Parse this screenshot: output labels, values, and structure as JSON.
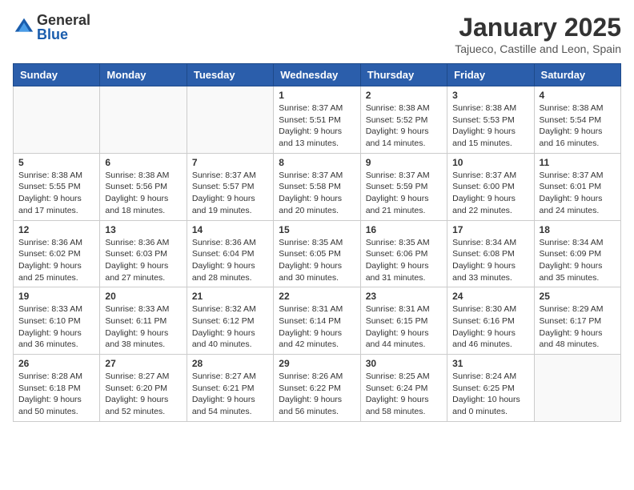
{
  "logo": {
    "general": "General",
    "blue": "Blue"
  },
  "title": "January 2025",
  "location": "Tajueco, Castille and Leon, Spain",
  "weekdays": [
    "Sunday",
    "Monday",
    "Tuesday",
    "Wednesday",
    "Thursday",
    "Friday",
    "Saturday"
  ],
  "weeks": [
    [
      {
        "day": "",
        "sunrise": "",
        "sunset": "",
        "daylight": ""
      },
      {
        "day": "",
        "sunrise": "",
        "sunset": "",
        "daylight": ""
      },
      {
        "day": "",
        "sunrise": "",
        "sunset": "",
        "daylight": ""
      },
      {
        "day": "1",
        "sunrise": "Sunrise: 8:37 AM",
        "sunset": "Sunset: 5:51 PM",
        "daylight": "Daylight: 9 hours and 13 minutes."
      },
      {
        "day": "2",
        "sunrise": "Sunrise: 8:38 AM",
        "sunset": "Sunset: 5:52 PM",
        "daylight": "Daylight: 9 hours and 14 minutes."
      },
      {
        "day": "3",
        "sunrise": "Sunrise: 8:38 AM",
        "sunset": "Sunset: 5:53 PM",
        "daylight": "Daylight: 9 hours and 15 minutes."
      },
      {
        "day": "4",
        "sunrise": "Sunrise: 8:38 AM",
        "sunset": "Sunset: 5:54 PM",
        "daylight": "Daylight: 9 hours and 16 minutes."
      }
    ],
    [
      {
        "day": "5",
        "sunrise": "Sunrise: 8:38 AM",
        "sunset": "Sunset: 5:55 PM",
        "daylight": "Daylight: 9 hours and 17 minutes."
      },
      {
        "day": "6",
        "sunrise": "Sunrise: 8:38 AM",
        "sunset": "Sunset: 5:56 PM",
        "daylight": "Daylight: 9 hours and 18 minutes."
      },
      {
        "day": "7",
        "sunrise": "Sunrise: 8:37 AM",
        "sunset": "Sunset: 5:57 PM",
        "daylight": "Daylight: 9 hours and 19 minutes."
      },
      {
        "day": "8",
        "sunrise": "Sunrise: 8:37 AM",
        "sunset": "Sunset: 5:58 PM",
        "daylight": "Daylight: 9 hours and 20 minutes."
      },
      {
        "day": "9",
        "sunrise": "Sunrise: 8:37 AM",
        "sunset": "Sunset: 5:59 PM",
        "daylight": "Daylight: 9 hours and 21 minutes."
      },
      {
        "day": "10",
        "sunrise": "Sunrise: 8:37 AM",
        "sunset": "Sunset: 6:00 PM",
        "daylight": "Daylight: 9 hours and 22 minutes."
      },
      {
        "day": "11",
        "sunrise": "Sunrise: 8:37 AM",
        "sunset": "Sunset: 6:01 PM",
        "daylight": "Daylight: 9 hours and 24 minutes."
      }
    ],
    [
      {
        "day": "12",
        "sunrise": "Sunrise: 8:36 AM",
        "sunset": "Sunset: 6:02 PM",
        "daylight": "Daylight: 9 hours and 25 minutes."
      },
      {
        "day": "13",
        "sunrise": "Sunrise: 8:36 AM",
        "sunset": "Sunset: 6:03 PM",
        "daylight": "Daylight: 9 hours and 27 minutes."
      },
      {
        "day": "14",
        "sunrise": "Sunrise: 8:36 AM",
        "sunset": "Sunset: 6:04 PM",
        "daylight": "Daylight: 9 hours and 28 minutes."
      },
      {
        "day": "15",
        "sunrise": "Sunrise: 8:35 AM",
        "sunset": "Sunset: 6:05 PM",
        "daylight": "Daylight: 9 hours and 30 minutes."
      },
      {
        "day": "16",
        "sunrise": "Sunrise: 8:35 AM",
        "sunset": "Sunset: 6:06 PM",
        "daylight": "Daylight: 9 hours and 31 minutes."
      },
      {
        "day": "17",
        "sunrise": "Sunrise: 8:34 AM",
        "sunset": "Sunset: 6:08 PM",
        "daylight": "Daylight: 9 hours and 33 minutes."
      },
      {
        "day": "18",
        "sunrise": "Sunrise: 8:34 AM",
        "sunset": "Sunset: 6:09 PM",
        "daylight": "Daylight: 9 hours and 35 minutes."
      }
    ],
    [
      {
        "day": "19",
        "sunrise": "Sunrise: 8:33 AM",
        "sunset": "Sunset: 6:10 PM",
        "daylight": "Daylight: 9 hours and 36 minutes."
      },
      {
        "day": "20",
        "sunrise": "Sunrise: 8:33 AM",
        "sunset": "Sunset: 6:11 PM",
        "daylight": "Daylight: 9 hours and 38 minutes."
      },
      {
        "day": "21",
        "sunrise": "Sunrise: 8:32 AM",
        "sunset": "Sunset: 6:12 PM",
        "daylight": "Daylight: 9 hours and 40 minutes."
      },
      {
        "day": "22",
        "sunrise": "Sunrise: 8:31 AM",
        "sunset": "Sunset: 6:14 PM",
        "daylight": "Daylight: 9 hours and 42 minutes."
      },
      {
        "day": "23",
        "sunrise": "Sunrise: 8:31 AM",
        "sunset": "Sunset: 6:15 PM",
        "daylight": "Daylight: 9 hours and 44 minutes."
      },
      {
        "day": "24",
        "sunrise": "Sunrise: 8:30 AM",
        "sunset": "Sunset: 6:16 PM",
        "daylight": "Daylight: 9 hours and 46 minutes."
      },
      {
        "day": "25",
        "sunrise": "Sunrise: 8:29 AM",
        "sunset": "Sunset: 6:17 PM",
        "daylight": "Daylight: 9 hours and 48 minutes."
      }
    ],
    [
      {
        "day": "26",
        "sunrise": "Sunrise: 8:28 AM",
        "sunset": "Sunset: 6:18 PM",
        "daylight": "Daylight: 9 hours and 50 minutes."
      },
      {
        "day": "27",
        "sunrise": "Sunrise: 8:27 AM",
        "sunset": "Sunset: 6:20 PM",
        "daylight": "Daylight: 9 hours and 52 minutes."
      },
      {
        "day": "28",
        "sunrise": "Sunrise: 8:27 AM",
        "sunset": "Sunset: 6:21 PM",
        "daylight": "Daylight: 9 hours and 54 minutes."
      },
      {
        "day": "29",
        "sunrise": "Sunrise: 8:26 AM",
        "sunset": "Sunset: 6:22 PM",
        "daylight": "Daylight: 9 hours and 56 minutes."
      },
      {
        "day": "30",
        "sunrise": "Sunrise: 8:25 AM",
        "sunset": "Sunset: 6:24 PM",
        "daylight": "Daylight: 9 hours and 58 minutes."
      },
      {
        "day": "31",
        "sunrise": "Sunrise: 8:24 AM",
        "sunset": "Sunset: 6:25 PM",
        "daylight": "Daylight: 10 hours and 0 minutes."
      },
      {
        "day": "",
        "sunrise": "",
        "sunset": "",
        "daylight": ""
      }
    ]
  ]
}
